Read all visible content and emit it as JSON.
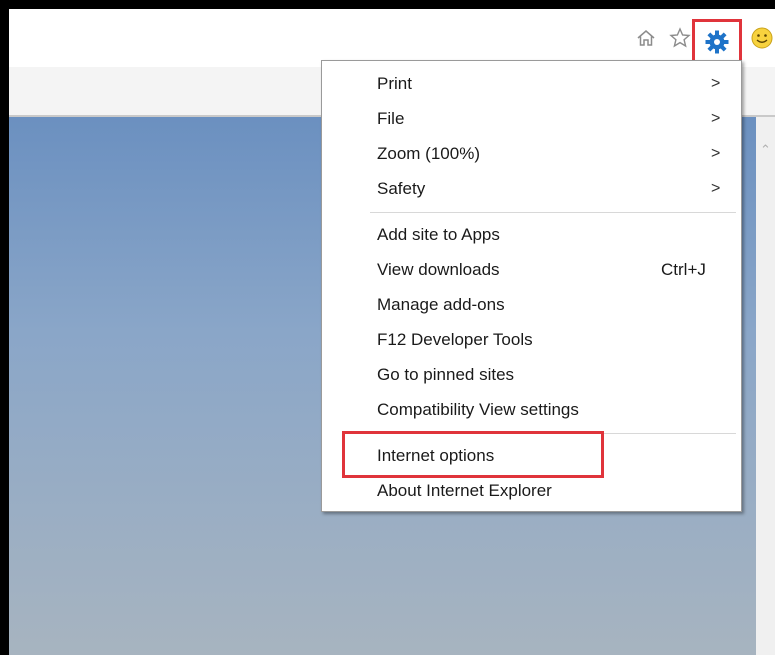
{
  "toolbar": {
    "icons": [
      "home-icon",
      "star-icon",
      "gear-icon",
      "smiley-icon"
    ],
    "accent": "#1e73c8",
    "highlight_color": "#e0343b"
  },
  "menu": {
    "items": [
      {
        "label": "Print",
        "submenu": ">"
      },
      {
        "label": "File",
        "submenu": ">"
      },
      {
        "label": "Zoom (100%)",
        "submenu": ">"
      },
      {
        "label": "Safety",
        "submenu": ">"
      },
      {
        "label": "Add site to Apps"
      },
      {
        "label": "View downloads",
        "shortcut": "Ctrl+J"
      },
      {
        "label": "Manage add-ons"
      },
      {
        "label": "F12 Developer Tools"
      },
      {
        "label": "Go to pinned sites"
      },
      {
        "label": "Compatibility View settings"
      },
      {
        "label": "Internet options"
      },
      {
        "label": "About Internet Explorer"
      }
    ]
  }
}
